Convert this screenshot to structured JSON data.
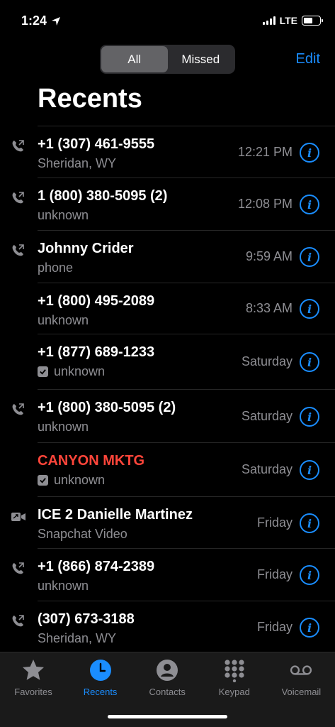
{
  "status": {
    "time": "1:24",
    "network": "LTE"
  },
  "segments": [
    {
      "label": "All",
      "active": true
    },
    {
      "label": "Missed",
      "active": false
    }
  ],
  "edit_label": "Edit",
  "title": "Recents",
  "calls": [
    {
      "name": "+1 (307) 461-9555",
      "sub": "Sheridan, WY",
      "time": "12:21 PM",
      "icon": "phone-outgoing-icon",
      "missed": false,
      "checkbox": false
    },
    {
      "name": "1 (800) 380-5095 (2)",
      "sub": "unknown",
      "time": "12:08 PM",
      "icon": "phone-outgoing-icon",
      "missed": false,
      "checkbox": false
    },
    {
      "name": "Johnny Crider",
      "sub": "phone",
      "time": "9:59 AM",
      "icon": "phone-outgoing-icon",
      "missed": false,
      "checkbox": false
    },
    {
      "name": "+1 (800) 495-2089",
      "sub": "unknown",
      "time": "8:33 AM",
      "icon": "",
      "missed": false,
      "checkbox": false
    },
    {
      "name": "+1 (877) 689-1233",
      "sub": "unknown",
      "time": "Saturday",
      "icon": "",
      "missed": false,
      "checkbox": true
    },
    {
      "name": "+1 (800) 380-5095 (2)",
      "sub": "unknown",
      "time": "Saturday",
      "icon": "phone-outgoing-icon",
      "missed": false,
      "checkbox": false
    },
    {
      "name": "CANYON MKTG",
      "sub": "unknown",
      "time": "Saturday",
      "icon": "",
      "missed": true,
      "checkbox": true
    },
    {
      "name": "ICE 2 Danielle Martinez",
      "sub": "Snapchat Video",
      "time": "Friday",
      "icon": "video-outgoing-icon",
      "missed": false,
      "checkbox": false
    },
    {
      "name": "+1 (866) 874-2389",
      "sub": "unknown",
      "time": "Friday",
      "icon": "phone-outgoing-icon",
      "missed": false,
      "checkbox": false
    },
    {
      "name": "(307) 673-3188",
      "sub": "Sheridan, WY",
      "time": "Friday",
      "icon": "phone-outgoing-icon",
      "missed": false,
      "checkbox": false
    }
  ],
  "tabs": [
    {
      "label": "Favorites",
      "icon": "star-icon",
      "active": false
    },
    {
      "label": "Recents",
      "icon": "clock-icon",
      "active": true
    },
    {
      "label": "Contacts",
      "icon": "person-icon",
      "active": false
    },
    {
      "label": "Keypad",
      "icon": "keypad-icon",
      "active": false
    },
    {
      "label": "Voicemail",
      "icon": "voicemail-icon",
      "active": false
    }
  ],
  "colors": {
    "accent": "#1a8dff",
    "missed": "#ff453a",
    "secondary": "#8e8e93"
  }
}
